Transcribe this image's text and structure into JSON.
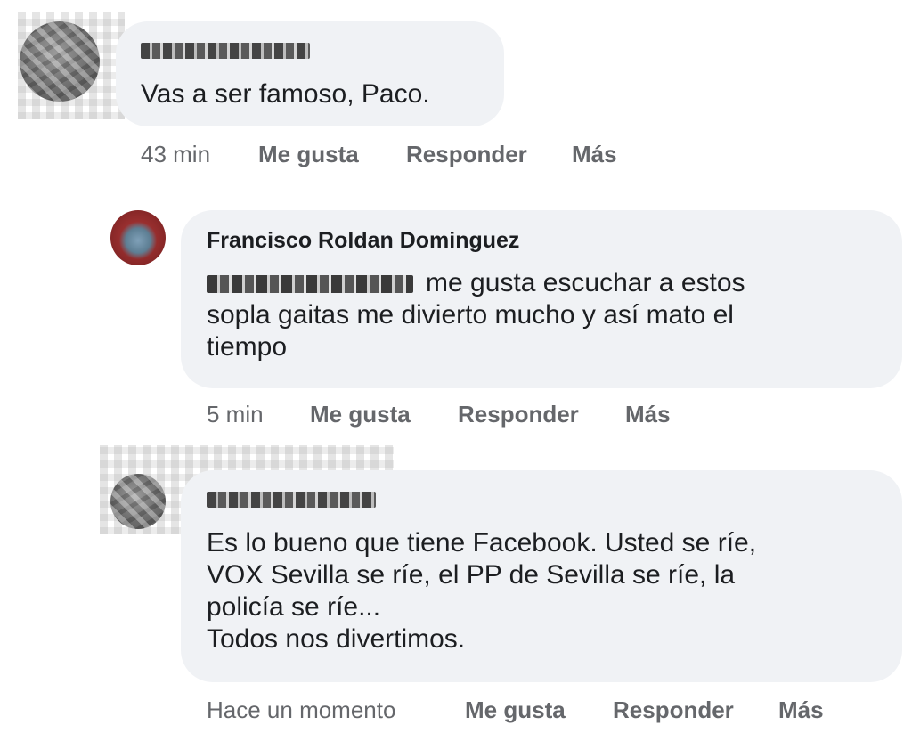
{
  "comments": [
    {
      "author": "",
      "text_lines": [
        "Vas a ser famoso, Paco."
      ],
      "time": "43 min",
      "like_label": "Me gusta",
      "reply_label": "Responder",
      "more_label": "Más"
    },
    {
      "author": "Francisco Roldan Dominguez",
      "text_first_line": "me gusta escuchar a estos",
      "text_lines": [
        "sopla gaitas me divierto mucho y así mato el",
        "tiempo"
      ],
      "time": "5 min",
      "like_label": "Me gusta",
      "reply_label": "Responder",
      "more_label": "Más"
    },
    {
      "author": "",
      "text_lines": [
        "Es lo bueno que tiene Facebook. Usted se ríe,",
        "VOX Sevilla se ríe, el PP de Sevilla se ríe, la",
        "policía se ríe...",
        "Todos nos divertimos."
      ],
      "time": "Hace un momento",
      "like_label": "Me gusta",
      "reply_label": "Responder",
      "more_label": "Más"
    }
  ]
}
